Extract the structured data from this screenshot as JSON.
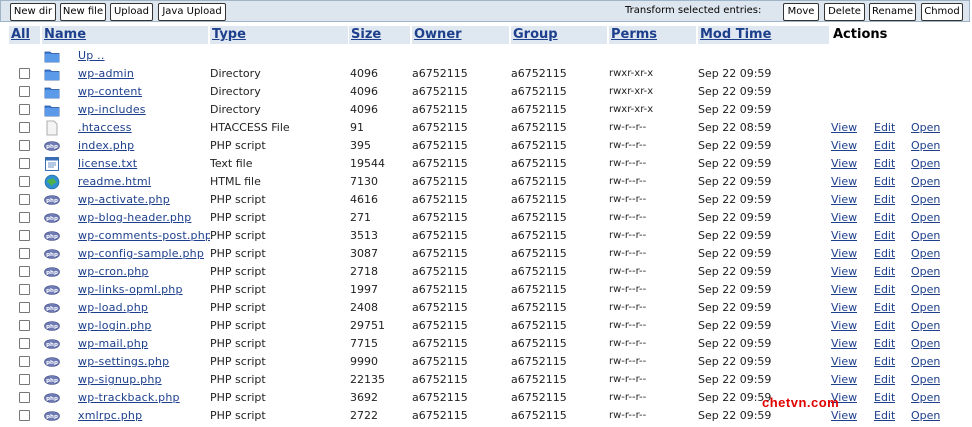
{
  "toolbar": {
    "new_dir": "New dir",
    "new_file": "New file",
    "upload": "Upload",
    "java_upload": "Java Upload",
    "transform_label": "Transform selected entries:",
    "move": "Move",
    "delete": "Delete",
    "rename": "Rename",
    "chmod": "Chmod"
  },
  "headers": {
    "all": "All",
    "name": "Name",
    "type": "Type",
    "size": "Size",
    "owner": "Owner",
    "group": "Group",
    "perms": "Perms",
    "modtime": "Mod Time",
    "actions": "Actions"
  },
  "actions": {
    "view": "View",
    "edit": "Edit",
    "open": "Open"
  },
  "rows": [
    {
      "icon": "folder-up-icon",
      "name": "Up ..",
      "type": "",
      "size": "",
      "owner": "",
      "group": "",
      "perms": "",
      "modtime": "",
      "has_checkbox": false,
      "has_actions": false
    },
    {
      "icon": "folder-icon",
      "name": "wp-admin",
      "type": "Directory",
      "size": "4096",
      "owner": "a6752115",
      "group": "a6752115",
      "perms": "rwxr-xr-x",
      "modtime": "Sep 22 09:59",
      "has_checkbox": true,
      "has_actions": false
    },
    {
      "icon": "folder-icon",
      "name": "wp-content",
      "type": "Directory",
      "size": "4096",
      "owner": "a6752115",
      "group": "a6752115",
      "perms": "rwxr-xr-x",
      "modtime": "Sep 22 09:59",
      "has_checkbox": true,
      "has_actions": false
    },
    {
      "icon": "folder-icon",
      "name": "wp-includes",
      "type": "Directory",
      "size": "4096",
      "owner": "a6752115",
      "group": "a6752115",
      "perms": "rwxr-xr-x",
      "modtime": "Sep 22 09:59",
      "has_checkbox": true,
      "has_actions": false
    },
    {
      "icon": "blank-file-icon",
      "name": ".htaccess",
      "type": "HTACCESS File",
      "size": "91",
      "owner": "a6752115",
      "group": "a6752115",
      "perms": "rw-r--r--",
      "modtime": "Sep 22 08:59",
      "has_checkbox": true,
      "has_actions": true
    },
    {
      "icon": "php-icon",
      "name": "index.php",
      "type": "PHP script",
      "size": "395",
      "owner": "a6752115",
      "group": "a6752115",
      "perms": "rw-r--r--",
      "modtime": "Sep 22 09:59",
      "has_checkbox": true,
      "has_actions": true
    },
    {
      "icon": "text-file-icon",
      "name": "license.txt",
      "type": "Text file",
      "size": "19544",
      "owner": "a6752115",
      "group": "a6752115",
      "perms": "rw-r--r--",
      "modtime": "Sep 22 09:59",
      "has_checkbox": true,
      "has_actions": true
    },
    {
      "icon": "html-file-icon",
      "name": "readme.html",
      "type": "HTML file",
      "size": "7130",
      "owner": "a6752115",
      "group": "a6752115",
      "perms": "rw-r--r--",
      "modtime": "Sep 22 09:59",
      "has_checkbox": true,
      "has_actions": true
    },
    {
      "icon": "php-icon",
      "name": "wp-activate.php",
      "type": "PHP script",
      "size": "4616",
      "owner": "a6752115",
      "group": "a6752115",
      "perms": "rw-r--r--",
      "modtime": "Sep 22 09:59",
      "has_checkbox": true,
      "has_actions": true
    },
    {
      "icon": "php-icon",
      "name": "wp-blog-header.php",
      "type": "PHP script",
      "size": "271",
      "owner": "a6752115",
      "group": "a6752115",
      "perms": "rw-r--r--",
      "modtime": "Sep 22 09:59",
      "has_checkbox": true,
      "has_actions": true
    },
    {
      "icon": "php-icon",
      "name": "wp-comments-post.php",
      "type": "PHP script",
      "size": "3513",
      "owner": "a6752115",
      "group": "a6752115",
      "perms": "rw-r--r--",
      "modtime": "Sep 22 09:59",
      "has_checkbox": true,
      "has_actions": true
    },
    {
      "icon": "php-icon",
      "name": "wp-config-sample.php",
      "type": "PHP script",
      "size": "3087",
      "owner": "a6752115",
      "group": "a6752115",
      "perms": "rw-r--r--",
      "modtime": "Sep 22 09:59",
      "has_checkbox": true,
      "has_actions": true
    },
    {
      "icon": "php-icon",
      "name": "wp-cron.php",
      "type": "PHP script",
      "size": "2718",
      "owner": "a6752115",
      "group": "a6752115",
      "perms": "rw-r--r--",
      "modtime": "Sep 22 09:59",
      "has_checkbox": true,
      "has_actions": true
    },
    {
      "icon": "php-icon",
      "name": "wp-links-opml.php",
      "type": "PHP script",
      "size": "1997",
      "owner": "a6752115",
      "group": "a6752115",
      "perms": "rw-r--r--",
      "modtime": "Sep 22 09:59",
      "has_checkbox": true,
      "has_actions": true
    },
    {
      "icon": "php-icon",
      "name": "wp-load.php",
      "type": "PHP script",
      "size": "2408",
      "owner": "a6752115",
      "group": "a6752115",
      "perms": "rw-r--r--",
      "modtime": "Sep 22 09:59",
      "has_checkbox": true,
      "has_actions": true
    },
    {
      "icon": "php-icon",
      "name": "wp-login.php",
      "type": "PHP script",
      "size": "29751",
      "owner": "a6752115",
      "group": "a6752115",
      "perms": "rw-r--r--",
      "modtime": "Sep 22 09:59",
      "has_checkbox": true,
      "has_actions": true
    },
    {
      "icon": "php-icon",
      "name": "wp-mail.php",
      "type": "PHP script",
      "size": "7715",
      "owner": "a6752115",
      "group": "a6752115",
      "perms": "rw-r--r--",
      "modtime": "Sep 22 09:59",
      "has_checkbox": true,
      "has_actions": true
    },
    {
      "icon": "php-icon",
      "name": "wp-settings.php",
      "type": "PHP script",
      "size": "9990",
      "owner": "a6752115",
      "group": "a6752115",
      "perms": "rw-r--r--",
      "modtime": "Sep 22 09:59",
      "has_checkbox": true,
      "has_actions": true
    },
    {
      "icon": "php-icon",
      "name": "wp-signup.php",
      "type": "PHP script",
      "size": "22135",
      "owner": "a6752115",
      "group": "a6752115",
      "perms": "rw-r--r--",
      "modtime": "Sep 22 09:59",
      "has_checkbox": true,
      "has_actions": true
    },
    {
      "icon": "php-icon",
      "name": "wp-trackback.php",
      "type": "PHP script",
      "size": "3692",
      "owner": "a6752115",
      "group": "a6752115",
      "perms": "rw-r--r--",
      "modtime": "Sep 22 09:59",
      "has_checkbox": true,
      "has_actions": true
    },
    {
      "icon": "php-icon",
      "name": "xmlrpc.php",
      "type": "PHP script",
      "size": "2722",
      "owner": "a6752115",
      "group": "a6752115",
      "perms": "rw-r--r--",
      "modtime": "Sep 22 09:59",
      "has_checkbox": true,
      "has_actions": true
    }
  ],
  "watermark": "chetvn.com",
  "colors": {
    "link": "#1d3f8c",
    "header_bg": "#dfe8f0",
    "toolbar_bg": "#dde6ee",
    "watermark": "#e00000"
  }
}
